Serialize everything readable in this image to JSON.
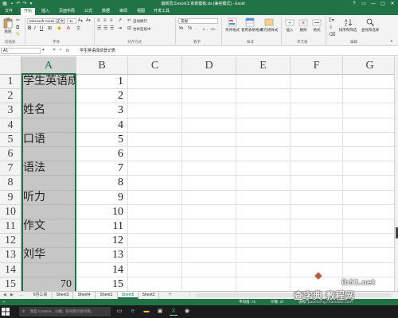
{
  "title_bar": {
    "title": "最新员工excel工资表模板.xls  [兼容模式] - Excel",
    "window_controls": [
      "?",
      "▭",
      "—",
      "▢",
      "✕"
    ]
  },
  "ribbon_tabs": [
    "文件",
    "开始",
    "插入",
    "页面布局",
    "公式",
    "数据",
    "审阅",
    "视图",
    "开发工具"
  ],
  "active_ribbon_tab": "开始",
  "ribbon": {
    "paste_label": "粘贴",
    "clipboard_group": "剪贴板",
    "font_name": "Microsoft YaHei (正文)",
    "font_size": "11",
    "font_group": "字体",
    "align_group": "对齐方式",
    "wrap_text": "自动换行",
    "merge_center": "合并后居中",
    "number_format": "常规",
    "number_group": "数字",
    "conditional_format": "条件格式",
    "format_table": "套用表格格式",
    "cell_styles": "单元格样式",
    "styles_group": "样式",
    "insert": "插入",
    "delete": "删除",
    "format": "格式",
    "cells_group": "单元格",
    "sort_filter": "排序和筛选",
    "find_select": "查找和选择",
    "editing_group": "编辑"
  },
  "formula_bar": {
    "name_box": "A1",
    "fx": "fx",
    "content": "学生英语成绩登记表"
  },
  "columns": [
    "A",
    "B",
    "C",
    "D",
    "E",
    "F",
    "G"
  ],
  "selected_column": "A",
  "rows": [
    {
      "n": "1",
      "a": "学生英语成绩",
      "b": "1"
    },
    {
      "n": "2",
      "a": "",
      "b": "2"
    },
    {
      "n": "3",
      "a": "姓名",
      "b": "3"
    },
    {
      "n": "4",
      "a": "",
      "b": "4"
    },
    {
      "n": "5",
      "a": "口语",
      "b": "5"
    },
    {
      "n": "6",
      "a": "",
      "b": "6"
    },
    {
      "n": "7",
      "a": "语法",
      "b": "7"
    },
    {
      "n": "8",
      "a": "",
      "b": "8"
    },
    {
      "n": "9",
      "a": "听力",
      "b": "9"
    },
    {
      "n": "10",
      "a": "",
      "b": "10"
    },
    {
      "n": "11",
      "a": "作文",
      "b": "11"
    },
    {
      "n": "12",
      "a": "",
      "b": "12"
    },
    {
      "n": "13",
      "a": "刘华",
      "b": "13"
    },
    {
      "n": "14",
      "a": "",
      "b": "14"
    },
    {
      "n": "15",
      "a": "70",
      "b": "15"
    }
  ],
  "sheet_tabs": [
    "5月工资",
    "Sheet3",
    "Sheet4",
    "Sheet1",
    "Sheet5",
    "Sheet2"
  ],
  "active_sheet": "Sheet5",
  "add_sheet": "+",
  "status_bar": {
    "average": "平均值: 71",
    "count": "计数: 37",
    "sum": "求和: 1..."
  },
  "taskbar": {
    "search_placeholder": "我是 Cortana，小娜。有问题尽管问我。"
  },
  "watermark": {
    "line1": "ib51.net",
    "line2": "查字典 教程网",
    "line3": "jiaocheng.chazidian.com"
  },
  "colors": {
    "excel_green": "#217346",
    "selection_gray": "#c6c6c6"
  }
}
